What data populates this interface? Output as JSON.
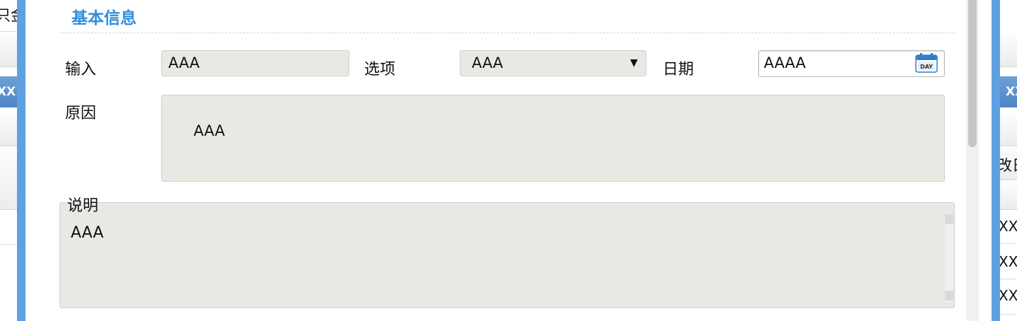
{
  "background_page": {
    "left_fragments": {
      "header_text": "只金",
      "blue_bar_text": "XX"
    },
    "right_fragments": {
      "blue_bar_text": "XX",
      "header_text": "改日",
      "row_texts": [
        "XX",
        "XX",
        "XX"
      ]
    }
  },
  "dialog": {
    "section_title": "基本信息",
    "fields": {
      "input": {
        "label": "输入",
        "value": "AAA"
      },
      "option": {
        "label": "选项",
        "value": "AAA",
        "arrow": "▼"
      },
      "date": {
        "label": "日期",
        "value": "AAAA",
        "icon": "calendar-icon",
        "icon_text": "DAY"
      },
      "reason": {
        "label": "原因",
        "value": "AAA"
      },
      "description": {
        "legend": "说明",
        "value": "AAA"
      }
    }
  },
  "colors": {
    "accent": "#2f8fe0",
    "frame": "#5fa1e0",
    "field_background": "#e9e8e2",
    "field_border": "#cfcfcf"
  }
}
